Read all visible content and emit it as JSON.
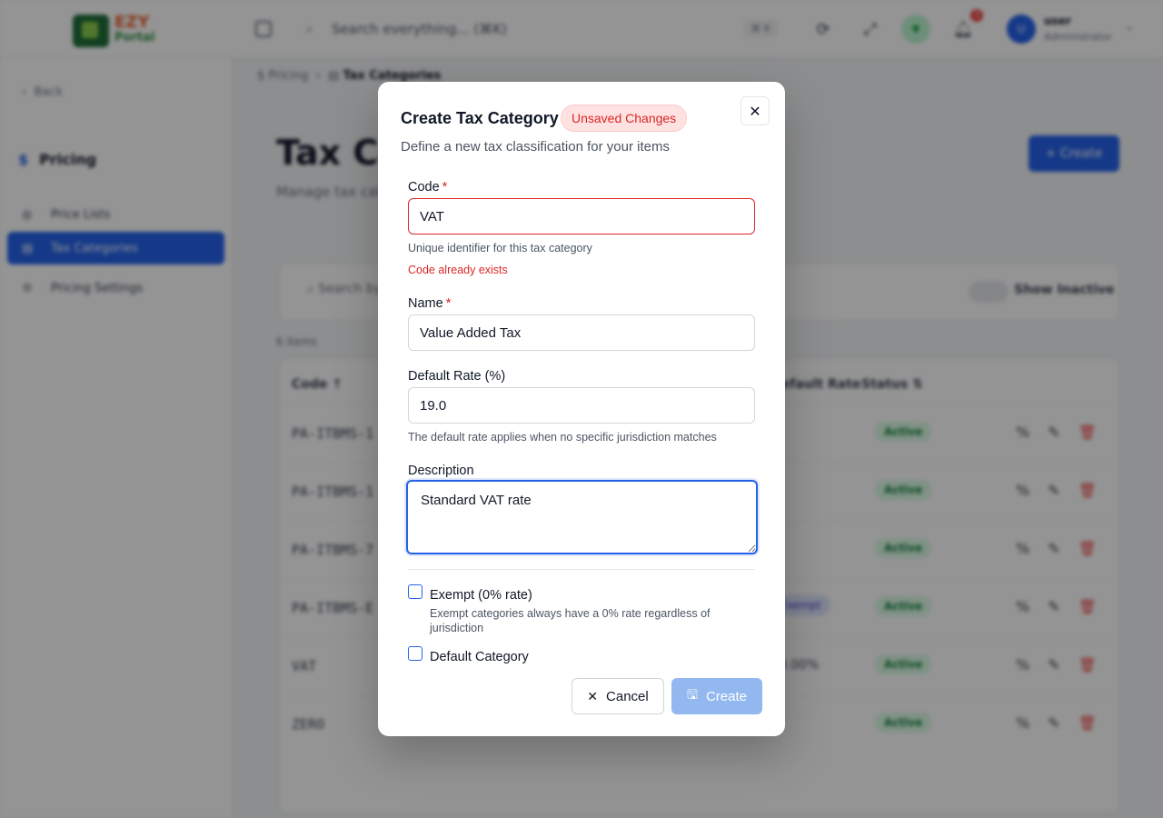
{
  "app": {
    "logo_line1": "EZY",
    "logo_line2": "Portal",
    "search_placeholder": "Search everything... (⌘K)",
    "search_shortcut": "⌘ K",
    "notifications_count": "3",
    "user_initial": "U",
    "user_name": "user",
    "user_role": "Administrator"
  },
  "sidebar": {
    "back_label": "Back",
    "section_title": "Pricing",
    "items": [
      {
        "label": "Price Lists",
        "icon": "globe-icon"
      },
      {
        "label": "Tax Categories",
        "icon": "clipboard-icon",
        "active": true
      },
      {
        "label": "Pricing Settings",
        "icon": "gear-icon"
      }
    ]
  },
  "page": {
    "breadcrumb_root": "Pricing",
    "breadcrumb_current": "Tax Categories",
    "title": "Tax Categories",
    "subtitle": "Manage tax categories",
    "create_label": "+ Create",
    "search_placeholder": "Search by code...",
    "show_inactive_label": "Show Inactive",
    "item_count": "6 items",
    "columns": {
      "code": "Code",
      "rate": "Default Rate",
      "status": "Status"
    },
    "rows": [
      {
        "code": "PA-ITBMS-1",
        "rate": "-",
        "exempt": "",
        "status": "Active"
      },
      {
        "code": "PA-ITBMS-1",
        "rate": "-",
        "exempt": "",
        "status": "Active"
      },
      {
        "code": "PA-ITBMS-7",
        "rate": "-",
        "exempt": "",
        "status": "Active"
      },
      {
        "code": "PA-ITBMS-E",
        "rate": "",
        "exempt": "Exempt",
        "status": "Active"
      },
      {
        "code": "VAT",
        "rate": "19.00%",
        "exempt": "",
        "status": "Active"
      },
      {
        "code": "ZERO",
        "rate": "-",
        "exempt": "",
        "status": "Active"
      }
    ]
  },
  "modal": {
    "title": "Create Tax Category",
    "badge": "Unsaved Changes",
    "subtitle": "Define a new tax classification for your items",
    "code_label": "Code",
    "code_value": "VAT",
    "code_help": "Unique identifier for this tax category",
    "code_error": "Code already exists",
    "name_label": "Name",
    "name_value": "Value Added Tax",
    "rate_label": "Default Rate (%)",
    "rate_value": "19.0",
    "rate_help": "The default rate applies when no specific jurisdiction matches",
    "description_label": "Description",
    "description_value": "Standard VAT rate",
    "exempt_label": "Exempt (0% rate)",
    "exempt_help": "Exempt categories always have a 0% rate regardless of jurisdiction",
    "default_label": "Default Category",
    "cancel_label": "Cancel",
    "create_label": "Create",
    "required_mark": "*"
  },
  "colors": {
    "accent": "#2563eb",
    "error": "#dc2626",
    "disabled_primary": "#93b8f0"
  }
}
